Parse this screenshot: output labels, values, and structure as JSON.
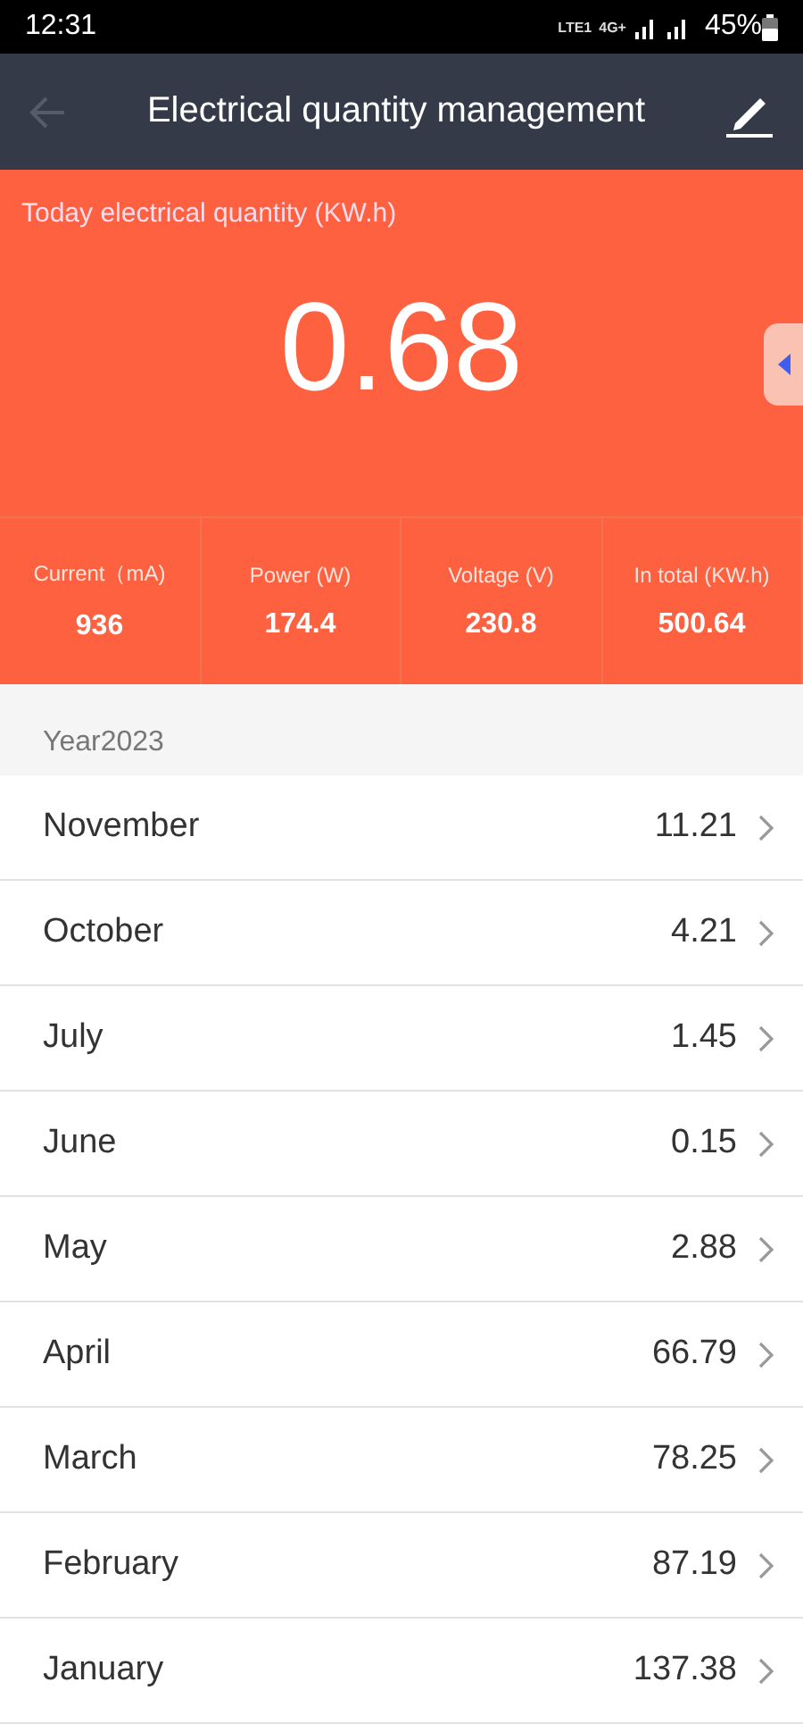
{
  "status_bar": {
    "time": "12:31",
    "network": [
      "LTE1",
      "4G+"
    ],
    "battery": "45%"
  },
  "header": {
    "title": "Electrical quantity management"
  },
  "today": {
    "label": "Today electrical quantity (KW.h)",
    "value": "0.68"
  },
  "stats": [
    {
      "label": "Current（mA)",
      "value": "936"
    },
    {
      "label": "Power (W)",
      "value": "174.4"
    },
    {
      "label": "Voltage (V)",
      "value": "230.8"
    },
    {
      "label": "In total (KW.h)",
      "value": "500.64"
    }
  ],
  "year": "Year2023",
  "months": [
    {
      "name": "November",
      "value": "11.21"
    },
    {
      "name": "October",
      "value": "4.21"
    },
    {
      "name": "July",
      "value": "1.45"
    },
    {
      "name": "June",
      "value": "0.15"
    },
    {
      "name": "May",
      "value": "2.88"
    },
    {
      "name": "April",
      "value": "66.79"
    },
    {
      "name": "March",
      "value": "78.25"
    },
    {
      "name": "February",
      "value": "87.19"
    },
    {
      "name": "January",
      "value": "137.38"
    }
  ]
}
